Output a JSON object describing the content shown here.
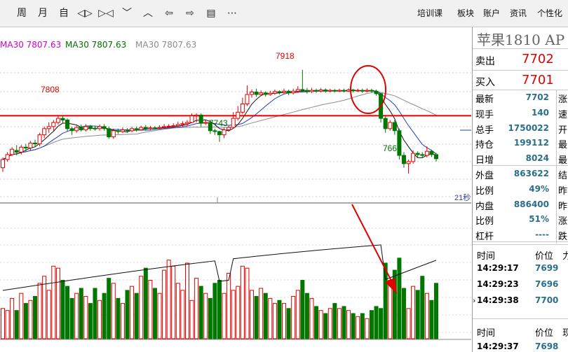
{
  "toolbar": {
    "buttons": [
      {
        "name": "week-period-button",
        "label": "周"
      },
      {
        "name": "month-period-button",
        "label": "月"
      },
      {
        "name": "auto-button",
        "label": "自"
      },
      {
        "name": "expand-icon",
        "label": "◁▷"
      },
      {
        "name": "shrink-icon",
        "label": "▷◁"
      },
      {
        "name": "down-icon",
        "label": "﹀"
      },
      {
        "name": "up-icon",
        "label": "︿"
      },
      {
        "name": "back-icon",
        "label": "⇦"
      },
      {
        "name": "forward-icon",
        "label": "⇨"
      },
      {
        "name": "layout-icon",
        "label": "▤"
      },
      {
        "name": "more-icon",
        "label": "⋯"
      }
    ],
    "links": [
      "培训课",
      "板块",
      "账户",
      "资讯",
      "个性化"
    ]
  },
  "legend": {
    "ma30_a": "MA30 7807.63",
    "ma30_b": "MA30 7807.63",
    "ma30_c": "MA30 7807.63"
  },
  "colors": {
    "up": "#e00000",
    "down": "#007700",
    "ma_blue": "#1f3fbf",
    "ma_gray": "#8c8c8c",
    "magenta": "#cc00cc",
    "green_text": "#006f00",
    "red": "#e00000"
  },
  "chart_labels": {
    "high": "7918",
    "left_level": "7808",
    "low1": "7743",
    "low2": "7666",
    "timer": "21秒"
  },
  "chart_data": {
    "type": "candlestick",
    "price_ylim": [
      7620,
      7960
    ],
    "reference_level": 7808,
    "candles": [
      [
        7680,
        7700,
        7670,
        7705
      ],
      [
        7700,
        7712,
        7695,
        7718
      ],
      [
        7712,
        7725,
        7708,
        7730
      ],
      [
        7722,
        7718,
        7710,
        7735
      ],
      [
        7718,
        7730,
        7712,
        7735
      ],
      [
        7730,
        7728,
        7720,
        7738
      ],
      [
        7728,
        7740,
        7722,
        7745
      ],
      [
        7740,
        7738,
        7730,
        7748
      ],
      [
        7738,
        7760,
        7732,
        7765
      ],
      [
        7760,
        7775,
        7752,
        7780
      ],
      [
        7775,
        7780,
        7765,
        7790
      ],
      [
        7780,
        7790,
        7770,
        7796
      ],
      [
        7790,
        7800,
        7785,
        7808
      ],
      [
        7800,
        7796,
        7788,
        7805
      ],
      [
        7796,
        7775,
        7768,
        7800
      ],
      [
        7775,
        7770,
        7760,
        7780
      ],
      [
        7770,
        7778,
        7765,
        7782
      ],
      [
        7778,
        7772,
        7768,
        7785
      ],
      [
        7772,
        7780,
        7768,
        7786
      ],
      [
        7780,
        7776,
        7770,
        7784
      ],
      [
        7776,
        7775,
        7770,
        7782
      ],
      [
        7775,
        7780,
        7770,
        7785
      ],
      [
        7780,
        7775,
        7770,
        7786
      ],
      [
        7775,
        7755,
        7750,
        7780
      ],
      [
        7755,
        7770,
        7750,
        7775
      ],
      [
        7770,
        7768,
        7762,
        7775
      ],
      [
        7768,
        7772,
        7764,
        7778
      ],
      [
        7772,
        7770,
        7765,
        7776
      ],
      [
        7770,
        7775,
        7766,
        7780
      ],
      [
        7775,
        7772,
        7768,
        7780
      ],
      [
        7772,
        7778,
        7770,
        7782
      ],
      [
        7778,
        7775,
        7770,
        7784
      ],
      [
        7775,
        7777,
        7772,
        7782
      ],
      [
        7777,
        7776,
        7773,
        7781
      ],
      [
        7776,
        7778,
        7774,
        7783
      ],
      [
        7778,
        7780,
        7775,
        7786
      ],
      [
        7780,
        7781,
        7776,
        7786
      ],
      [
        7781,
        7782,
        7777,
        7788
      ],
      [
        7782,
        7785,
        7778,
        7792
      ],
      [
        7785,
        7787,
        7780,
        7793
      ],
      [
        7787,
        7790,
        7782,
        7796
      ],
      [
        7790,
        7806,
        7788,
        7812
      ],
      [
        7806,
        7808,
        7790,
        7812
      ],
      [
        7808,
        7788,
        7780,
        7812
      ],
      [
        7788,
        7790,
        7784,
        7796
      ],
      [
        7790,
        7770,
        7762,
        7794
      ],
      [
        7770,
        7768,
        7760,
        7775
      ],
      [
        7768,
        7760,
        7743,
        7770
      ],
      [
        7760,
        7772,
        7752,
        7778
      ],
      [
        7772,
        7778,
        7768,
        7782
      ],
      [
        7778,
        7800,
        7776,
        7815
      ],
      [
        7800,
        7815,
        7795,
        7830
      ],
      [
        7815,
        7835,
        7810,
        7850
      ],
      [
        7835,
        7858,
        7830,
        7880
      ],
      [
        7858,
        7864,
        7850,
        7870
      ],
      [
        7864,
        7858,
        7852,
        7872
      ],
      [
        7858,
        7862,
        7854,
        7868
      ],
      [
        7862,
        7858,
        7853,
        7866
      ],
      [
        7858,
        7861,
        7855,
        7867
      ],
      [
        7861,
        7865,
        7857,
        7870
      ],
      [
        7865,
        7863,
        7858,
        7868
      ],
      [
        7863,
        7866,
        7860,
        7872
      ],
      [
        7866,
        7862,
        7856,
        7870
      ],
      [
        7862,
        7866,
        7858,
        7872
      ],
      [
        7866,
        7870,
        7862,
        7878
      ],
      [
        7870,
        7868,
        7864,
        7918
      ],
      [
        7868,
        7865,
        7860,
        7874
      ],
      [
        7865,
        7868,
        7862,
        7874
      ],
      [
        7868,
        7866,
        7862,
        7872
      ],
      [
        7866,
        7869,
        7863,
        7874
      ],
      [
        7869,
        7866,
        7862,
        7873
      ],
      [
        7866,
        7868,
        7863,
        7872
      ],
      [
        7868,
        7866,
        7863,
        7871
      ],
      [
        7866,
        7868,
        7864,
        7872
      ],
      [
        7868,
        7866,
        7863,
        7872
      ],
      [
        7866,
        7869,
        7864,
        7873
      ],
      [
        7869,
        7867,
        7863,
        7872
      ],
      [
        7867,
        7868,
        7864,
        7872
      ],
      [
        7868,
        7866,
        7862,
        7872
      ],
      [
        7866,
        7868,
        7863,
        7873
      ],
      [
        7868,
        7866,
        7862,
        7872
      ],
      [
        7866,
        7860,
        7855,
        7870
      ],
      [
        7860,
        7800,
        7790,
        7862
      ],
      [
        7800,
        7775,
        7765,
        7805
      ],
      [
        7775,
        7790,
        7770,
        7796
      ],
      [
        7790,
        7770,
        7760,
        7796
      ],
      [
        7770,
        7710,
        7700,
        7775
      ],
      [
        7710,
        7690,
        7680,
        7718
      ],
      [
        7690,
        7695,
        7666,
        7700
      ],
      [
        7695,
        7715,
        7690,
        7722
      ],
      [
        7715,
        7712,
        7705,
        7720
      ],
      [
        7712,
        7710,
        7705,
        7718
      ],
      [
        7710,
        7720,
        7705,
        7732
      ],
      [
        7720,
        7712,
        7706,
        7724
      ],
      [
        7712,
        7702,
        7695,
        7716
      ]
    ],
    "volume": [
      30,
      28,
      40,
      28,
      45,
      35,
      38,
      42,
      55,
      62,
      48,
      72,
      70,
      58,
      52,
      40,
      45,
      50,
      42,
      35,
      50,
      38,
      45,
      60,
      55,
      40,
      35,
      48,
      52,
      45,
      62,
      70,
      58,
      50,
      45,
      68,
      78,
      72,
      55,
      48,
      75,
      38,
      60,
      52,
      45,
      40,
      55,
      58,
      45,
      65,
      48,
      52,
      72,
      70,
      48,
      42,
      50,
      45,
      40,
      35,
      38,
      35,
      30,
      42,
      48,
      58,
      45,
      40,
      32,
      28,
      25,
      30,
      35,
      30,
      32,
      28,
      25,
      22,
      25,
      20,
      28,
      32,
      30,
      75,
      58,
      68,
      80,
      50,
      30,
      52,
      48,
      62,
      45,
      38,
      55
    ],
    "vol_ylim": [
      0,
      100
    ]
  },
  "quote_panel": {
    "title": "苹果1810 AP",
    "ask_label": "卖出",
    "ask_value": "7702",
    "bid_label": "买入",
    "bid_value": "7701",
    "rows": [
      {
        "label": "最新",
        "value": "7702",
        "xtra": "涨"
      },
      {
        "label": "现手",
        "value": "140",
        "xtra": "速"
      },
      {
        "label": "总手",
        "value": "1750022",
        "xtra": "开"
      },
      {
        "label": "持仓",
        "value": "199112",
        "xtra": "最"
      },
      {
        "label": "日增",
        "value": "8024",
        "xtra": "最"
      },
      {
        "label": "外盘",
        "value": "863622",
        "xtra": "结"
      },
      {
        "label": "比例",
        "value": "49%",
        "xtra": "昨"
      },
      {
        "label": "内盘",
        "value": "886400",
        "xtra": "昨"
      },
      {
        "label": "比例",
        "value": "51%",
        "xtra": "涨"
      },
      {
        "label": "杠杆",
        "value": "----",
        "xtra": "跌"
      }
    ],
    "trades_header": {
      "time": "时间",
      "price": "价位",
      "extra": "力"
    },
    "trades": [
      {
        "time": "14:29:17",
        "price": "7699"
      },
      {
        "time": "14:29:23",
        "price": "7696"
      },
      {
        "time": "14:29:38",
        "price": "7700"
      }
    ],
    "trades_header2": {
      "time": "时间",
      "price": "价位",
      "extra": "现"
    },
    "trades2": [
      {
        "time": "14:29:37",
        "price": "7698"
      }
    ]
  }
}
